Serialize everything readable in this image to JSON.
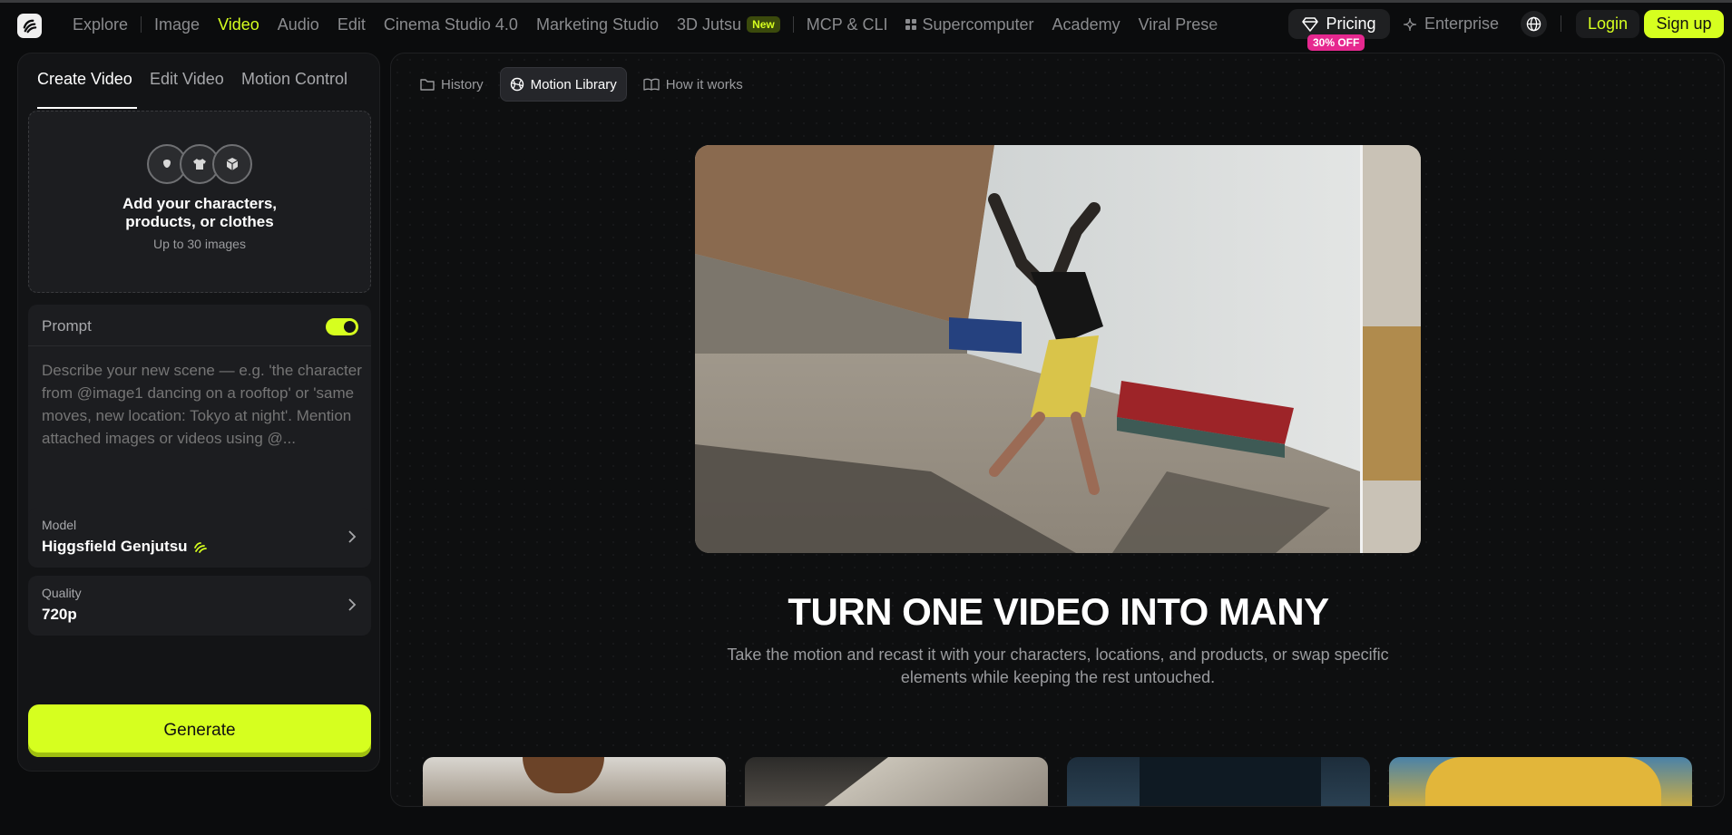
{
  "nav": {
    "items": [
      {
        "label": "Explore",
        "active": false
      },
      {
        "label": "Image",
        "active": false
      },
      {
        "label": "Video",
        "active": true
      },
      {
        "label": "Audio",
        "active": false
      },
      {
        "label": "Edit",
        "active": false
      },
      {
        "label": "Cinema Studio 4.0",
        "active": false
      },
      {
        "label": "Marketing Studio",
        "active": false
      },
      {
        "label": "3D Jutsu",
        "active": false,
        "badge": "New"
      },
      {
        "label": "MCP & CLI",
        "active": false
      },
      {
        "label": "Supercomputer",
        "active": false
      },
      {
        "label": "Academy",
        "active": false
      },
      {
        "label": "Viral Prese",
        "active": false
      }
    ],
    "pricing_label": "Pricing",
    "pricing_badge": "30% OFF",
    "enterprise_label": "Enterprise",
    "login_label": "Login",
    "signup_label": "Sign up",
    "accent": "#d6ff1f"
  },
  "left": {
    "tabs": [
      "Create Video",
      "Edit Video",
      "Motion Control"
    ],
    "upload": {
      "title": "Add your characters, products, or clothes",
      "subtitle": "Up to 30 images",
      "icons": [
        "face-icon",
        "shirt-icon",
        "box-icon"
      ]
    },
    "prompt": {
      "label": "Prompt",
      "toggle_on": true,
      "placeholder": "Describe your new scene — e.g. 'the character from @image1 dancing on a rooftop' or 'same moves, new location: Tokyo at night'. Mention attached images or videos using @..."
    },
    "model": {
      "label": "Model",
      "value": "Higgsfield Genjutsu"
    },
    "quality": {
      "label": "Quality",
      "value": "720p"
    },
    "generate_label": "Generate"
  },
  "main": {
    "subtabs": [
      {
        "label": "History",
        "icon": "folder-icon",
        "active": false
      },
      {
        "label": "Motion Library",
        "icon": "ball-icon",
        "active": true
      },
      {
        "label": "How it works",
        "icon": "book-icon",
        "active": false
      }
    ],
    "headline": "TURN ONE VIDEO INTO MANY",
    "subheadline": "Take the motion and recast it with your characters, locations, and products, or swap specific elements while keeping the rest untouched."
  }
}
